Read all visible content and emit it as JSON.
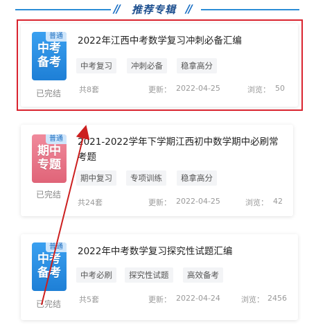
{
  "section": {
    "title": "推荐专辑",
    "slashes": "//"
  },
  "albums": [
    {
      "thumb": {
        "badge": "普通",
        "line1": "中考",
        "line2": "备考",
        "color": "#2a8de6"
      },
      "status": "已完结",
      "title": "2022年江西中考数学复习冲刺必备汇编",
      "tags": [
        "中考复习",
        "冲刺必备",
        "稳拿高分"
      ],
      "count": "共8套",
      "updated_label": "更新：",
      "updated": "2022-04-25",
      "views_label": "浏览：",
      "views": "50"
    },
    {
      "thumb": {
        "badge": "普通",
        "line1": "期中",
        "line2": "专题",
        "color": "#e8768a"
      },
      "status": "已完结",
      "title": "2021-2022学年下学期江西初中数学期中必刷常考题",
      "tags": [
        "期中复习",
        "专项训练",
        "稳拿高分"
      ],
      "count": "共24套",
      "updated_label": "更新：",
      "updated": "2022-04-25",
      "views_label": "浏览：",
      "views": "42"
    },
    {
      "thumb": {
        "badge": "普通",
        "line1": "中考",
        "line2": "备考",
        "color": "#2a8de6"
      },
      "status": "已完结",
      "title": "2022年中考数学复习探究性试题汇编",
      "tags": [
        "中考必刷",
        "探究性试题",
        "高效备考"
      ],
      "count": "共5套",
      "updated_label": "更新：",
      "updated": "2022-04-24",
      "views_label": "浏览：",
      "views": "2456"
    }
  ],
  "annotation": {
    "highlight_color": "#d9232e",
    "arrow_color": "#cc1f1f"
  }
}
